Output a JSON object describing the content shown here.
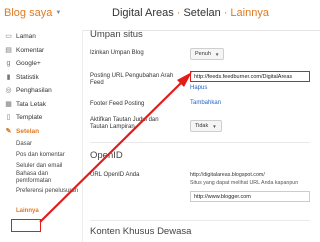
{
  "header": {
    "brand": "Blog saya",
    "crumbs": [
      "Digital Areas",
      "Setelan",
      "Lainnya"
    ],
    "separator": "·"
  },
  "sidebar": {
    "items": [
      {
        "label": "Laman",
        "icon": "page-icon"
      },
      {
        "label": "Komentar",
        "icon": "comment-icon"
      },
      {
        "label": "Google+",
        "icon": "google-plus-icon"
      },
      {
        "label": "Statistik",
        "icon": "stats-icon"
      },
      {
        "label": "Penghasilan",
        "icon": "earnings-icon"
      },
      {
        "label": "Tata Letak",
        "icon": "layout-icon"
      },
      {
        "label": "Template",
        "icon": "template-icon"
      },
      {
        "label": "Setelan",
        "icon": "wrench-icon",
        "active": true
      }
    ],
    "subitems": [
      "Dasar",
      "Pos dan komentar",
      "Seluler dan email",
      "Bahasa dan pemformatan",
      "Preferensi penelusuran",
      "Lainnya"
    ]
  },
  "main": {
    "section_feed": "Umpan situs",
    "allow_feed_label": "Izinkan Umpan Blog",
    "allow_feed_value": "Penuh",
    "redirect_label": "Posting URL Pengubahan Arah Feed",
    "redirect_value": "http://feeds.feedburner.com/DigitalAreas",
    "delete_link": "Hapus",
    "footer_label": "Footer Feed Posting",
    "footer_link": "Tambahkan",
    "enclosure_label": "Aktifkan Tautan Judul dan Tautan Lampiran",
    "enclosure_value": "Tidak",
    "section_openid": "OpenID",
    "openid_label": "URL OpenID Anda",
    "openid_url": "http://digitalareas.blogspot.com/",
    "openid_hint": "Situs yang dapat melihat URL Anda kapanpun",
    "openid_field": "http://www.blogger.com",
    "section_adult": "Konten Khusus Dewasa"
  },
  "colors": {
    "accent": "#e07a22",
    "annotation": "#e21b1b",
    "link": "#2266cc"
  }
}
